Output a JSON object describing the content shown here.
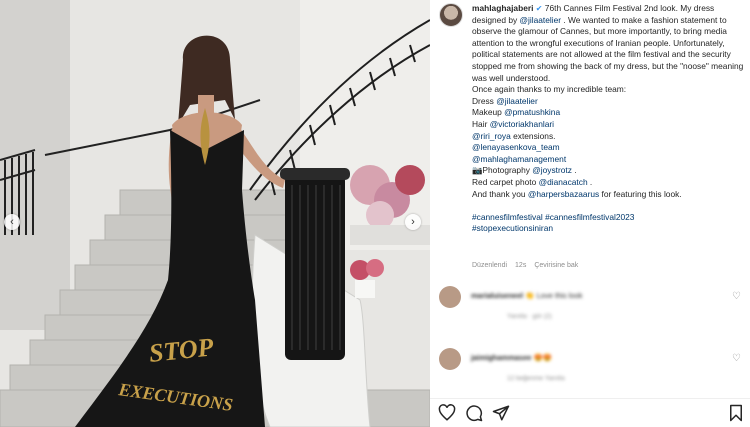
{
  "post": {
    "username": "mahlaghajaberi",
    "verified_icon": "✔",
    "caption_lines": [
      " 76th Cannes Film Festival 2nd look. My dress designed by ",
      "@jilaatelier",
      " . We wanted to make a fashion statement to observe the glamour of Cannes, but more importantly, to bring media attention to the wrongful executions of Iranian people. Unfortunately, political statements are not allowed at the film festival and the security stopped me from showing the back of my dress, but the \"noose\" meaning was well understood.",
      "Once again thanks to my incredible team:",
      "Dress ",
      "@jilaatelier",
      "Makeup ",
      "@pmatushkina",
      "Hair ",
      "@victoriakhanlari",
      "@riri_roya",
      " extensions.",
      "@lenayasenkova_team",
      "@mahlaghamanagement",
      "📷Photography ",
      "@joystrotz",
      " .",
      "Red carpet photo ",
      "@dianacatch",
      " .",
      "And thank you ",
      "@harpersbazaarus",
      " for featuring this look.",
      "#cannesfilmfestival #cannesfilmfestival2023",
      "#stopexecutionsiniran"
    ],
    "edited_label": "Düzenlendi",
    "time_ago": "12s",
    "translate_label": "Çevirisine bak"
  },
  "comments": [
    {
      "user": "marialuiseneel",
      "text": "👏 Love this look",
      "sub": "Yanıtla ·  gör (2)"
    },
    {
      "user": "jaimighammasee",
      "text": "😍😍",
      "sub": "12 beğenme   Yanıtla"
    }
  ],
  "photo": {
    "dress_text_line1": "STOP",
    "dress_text_line2": "EXECUTIONS"
  },
  "icons": {
    "carousel_prev": "‹",
    "carousel_next": "›",
    "heart": "♡"
  }
}
